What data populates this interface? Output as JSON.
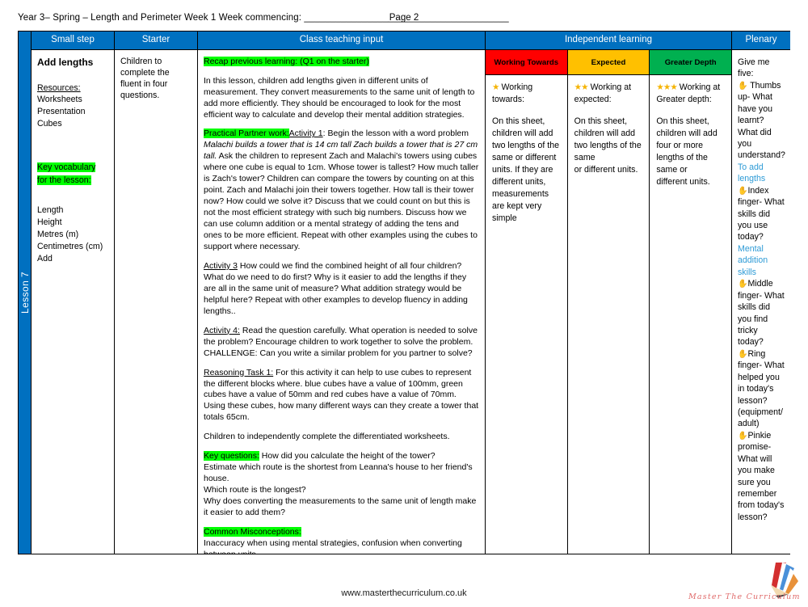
{
  "header": {
    "title": "Year 3– Spring – Length and Perimeter Week 1 Week commencing: _______________________________________",
    "page_number": "Page 2"
  },
  "lesson_spine": {
    "label": "Lesson 7"
  },
  "columns": {
    "small_step": "Small step",
    "starter": "Starter",
    "class_teaching_input": "Class teaching input",
    "independent_learning": "Independent learning",
    "plenary": "Plenary"
  },
  "small_step": {
    "title": "Add lengths",
    "resources_heading": "Resources:",
    "resources": [
      "Worksheets",
      "Presentation",
      "Cubes"
    ],
    "key_vocab_heading_line1": "Key vocabulary",
    "key_vocab_heading_line2": "for the lesson:",
    "vocabulary": [
      "Length",
      "Height",
      "Metres (m)",
      "Centimetres (cm)",
      "Add"
    ]
  },
  "starter": {
    "text": "Children to complete the fluent in four questions."
  },
  "class_teaching_input": {
    "recap_label": "Recap previous learning: (Q1 on the starter)",
    "intro": "In this lesson, children add lengths given in different units of measurement. They convert measurements to the same unit of length to add more efficiently. They should be encouraged to look for the most efficient way to calculate and develop their mental addition strategies.",
    "practical_label": "Practical Partner work:",
    "activity1_label": "Activity 1",
    "activity1_lead": ": Begin the lesson with a word problem",
    "activity1_italic": "Malachi builds a tower that is 14 cm tall Zach builds a tower that is 27 cm tall.",
    "activity1_body": " Ask the children to represent Zach and Malachi's towers using cubes where one cube is equal to 1cm.  Whose tower is tallest?  How much taller is Zach's tower?  Children can compare the towers by counting on at this point.   Zach and Malachi join their towers together. How tall is their tower now?  How could we solve it?  Discuss that we could count on but this is not the most efficient strategy with such big numbers.  Discuss how we can use column addition or a mental strategy of adding the tens and ones to be more efficient.  Repeat with other examples using the cubes to support where necessary.",
    "activity3_label": "Activity 3",
    "activity3_body": "  How could we find the combined height of all four children?  What do we need to do first?  Why is it easier to add the lengths if they are all in the same unit of measure?  What addition strategy would be helpful here?  Repeat with other examples to develop fluency in adding lengths..",
    "activity4_label": "Activity 4:",
    "activity4_body": "  Read the question carefully.  What operation is needed to solve the problem?  Encourage children to work together to solve the problem. CHALLENGE:  Can you write a similar problem for you partner to solve?",
    "reasoning_label": "Reasoning Task 1:",
    "reasoning_body": "   For this activity it can help to use  cubes to represent the different blocks where. blue cubes have a value of 100mm, green cubes have a value of 50mm and red cubes have a value of 70mm.  Using these cubes, how many different ways can they create a tower that totals 65cm.",
    "independent_note": "Children to independently complete the differentiated worksheets.",
    "key_questions_label": "Key questions:",
    "key_questions_first": " How did you calculate the height of the tower?",
    "key_questions_rest": "Estimate which route is the shortest from Leanna's house to her friend's house.\nWhich route is the longest?\nWhy does converting the measurements to the same unit of length make it easier to add them?",
    "misconceptions_label": "Common Misconceptions:",
    "misconceptions_body": "Inaccuracy when using mental strategies, confusion when converting between units"
  },
  "independent_learning": {
    "levels": [
      {
        "name": "Working Towards",
        "color": "#FF0000",
        "stars": "★",
        "heading": " Working towards:",
        "body": "On this sheet, children will add two lengths of the same or different units. If they are different units, measurements are kept very simple"
      },
      {
        "name": "Expected",
        "color": "#FFC000",
        "stars": "★★",
        "heading": " Working at expected:",
        "body": "On this sheet, children will add two lengths of the same\nor different units."
      },
      {
        "name": "Greater Depth",
        "color": "#00B050",
        "stars": "★★★",
        "heading": " Working at Greater depth:",
        "body": "On this sheet, children will add four or more lengths of the same or\ndifferent units."
      }
    ]
  },
  "plenary": {
    "intro": "Give me five:",
    "hand_icon": "✋",
    "items": [
      {
        "prompt": " Thumbs up- What have you learnt? What did you understand?",
        "answer": "To add lengths"
      },
      {
        "prompt": "Index finger- What skills did you use today?",
        "answer": "Mental addition skills"
      },
      {
        "prompt": "Middle finger- What skills did you find tricky today?",
        "answer": ""
      },
      {
        "prompt": "Ring finger- What helped you in today's lesson? (equipment/ adult)",
        "answer": ""
      },
      {
        "prompt": "Pinkie promise- What will you make sure you remember from today's lesson?",
        "answer": ""
      }
    ]
  },
  "footer": {
    "url": "www.masterthecurriculum.co.uk",
    "logo_text": "Master The Curriculum"
  },
  "colors": {
    "header_blue": "#0070C0",
    "highlight_green": "#00FF00",
    "answer_blue": "#2E9BD6",
    "star_gold": "#F5B301"
  }
}
